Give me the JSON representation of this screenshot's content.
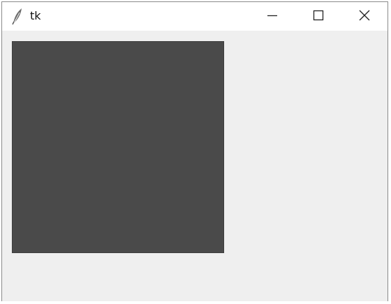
{
  "window": {
    "title": "tk",
    "icon": "feather-icon",
    "controls": [
      "minimize-icon",
      "maximize-icon",
      "close-icon"
    ]
  },
  "canvas": {
    "fill": "#4a4a4a"
  }
}
